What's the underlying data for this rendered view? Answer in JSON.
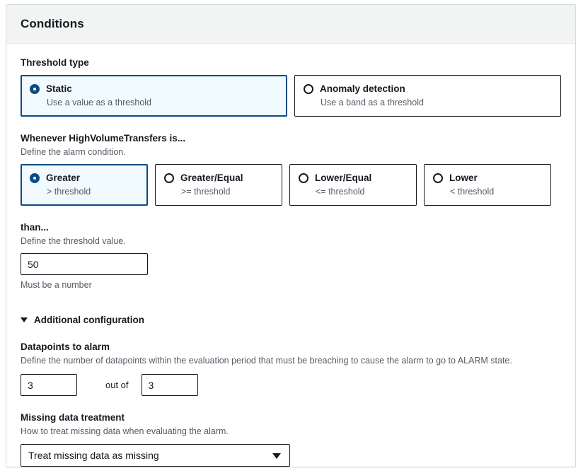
{
  "panel": {
    "title": "Conditions"
  },
  "threshold_type": {
    "label": "Threshold type",
    "options": [
      {
        "title": "Static",
        "subtitle": "Use a value as a threshold",
        "selected": true
      },
      {
        "title": "Anomaly detection",
        "subtitle": "Use a band as a threshold",
        "selected": false
      }
    ]
  },
  "condition": {
    "label": "Whenever HighVolumeTransfers is...",
    "description": "Define the alarm condition.",
    "metric_name": "HighVolumeTransfers",
    "options": [
      {
        "title": "Greater",
        "subtitle": "> threshold",
        "selected": true
      },
      {
        "title": "Greater/Equal",
        "subtitle": ">= threshold",
        "selected": false
      },
      {
        "title": "Lower/Equal",
        "subtitle": "<= threshold",
        "selected": false
      },
      {
        "title": "Lower",
        "subtitle": "< threshold",
        "selected": false
      }
    ]
  },
  "threshold_value": {
    "label": "than...",
    "description": "Define the threshold value.",
    "value": "50",
    "placeholder": "",
    "constraint": "Must be a number"
  },
  "additional_configuration": {
    "label": "Additional configuration",
    "expanded": true,
    "caret_icon": "caret-down-icon"
  },
  "datapoints": {
    "label": "Datapoints to alarm",
    "description": "Define the number of datapoints within the evaluation period that must be breaching to cause the alarm to go to ALARM state.",
    "breaching_value": "3",
    "separator_label": "out of",
    "evaluation_value": "3"
  },
  "missing_data": {
    "label": "Missing data treatment",
    "description": "How to treat missing data when evaluating the alarm.",
    "selected": "Treat missing data as missing",
    "caret_icon": "chevron-down-icon"
  },
  "colors": {
    "accent": "#0a4a86",
    "selected_fill": "#f1faff",
    "header_bg": "#f2f3f3",
    "border": "#16191f",
    "text_secondary": "#545b64"
  }
}
